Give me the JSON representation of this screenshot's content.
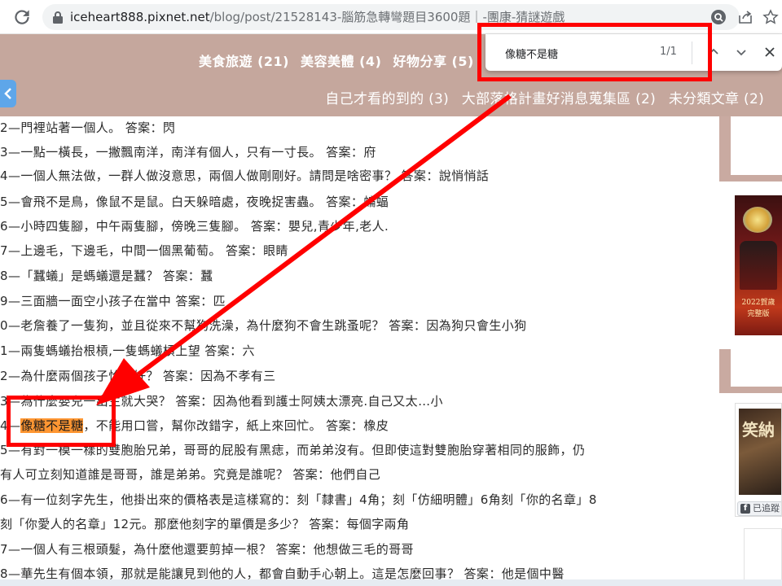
{
  "browser": {
    "url_host": "iceheart888.pixnet.net",
    "url_path": "/blog/post/21528143-腦筋急轉彎題目3600題｜-團康-猜謎遊戲",
    "icons": [
      "reload-icon",
      "lock-icon",
      "lens-icon",
      "share-icon",
      "star-icon"
    ]
  },
  "find_bar": {
    "query": "像糖不是糖",
    "count": "1/1",
    "icons": [
      "chevron-up-icon",
      "chevron-down-icon",
      "close-icon"
    ]
  },
  "categories_row1": [
    "美食旅遊 (21)",
    "美容美體 (4)",
    "好物分享 (5)"
  ],
  "categories_row2": [
    "自己才看的到的 (3)",
    "大部落格計畫好消息蒐集區 (2)",
    "未分類文章 (2)"
  ],
  "article_lines": [
    "2—門裡站著一個人。 答案：閃",
    "3—一點一橫長，一撇飄南洋，南洋有個人，只有一寸長。 答案：府",
    "4—一個人無法做，一群人做沒意思，兩個人做剛剛好。請問是啥密事？ 答案：說悄悄話",
    "5—會飛不是鳥，像鼠不是鼠。白天躲暗處，夜晚捉害蟲。 答案：蝙蝠",
    "6—小時四隻腳，中午兩隻腳，傍晚三隻腳。 答案：嬰兒,青少年,老人.",
    "7—上邊毛，下邊毛，中間一個黑葡萄。 答案：眼睛",
    "8—「蠶蟻」是螞蟻還是蠶？ 答案：蠶",
    "9—三面牆一面空小孩子在當中 答案：匹",
    "0—老詹養了一隻狗，並且從來不幫狗洗澡，為什麼狗不會生跳蚤呢？ 答案：因為狗只會生小狗",
    "1—兩隻螞蟻抬根槓,一隻螞蟻槓上望 答案：六",
    "2—為什麼兩個孩子恰恰好？ 答案：因為不孝有三",
    "3—為什麼嬰兒一出生就大哭？ 答案：因為他看到護士阿姨太漂亮.自己又太…小",
    "5—有對一模一樣的雙胞胎兄弟，哥哥的屁股有黑痣，而弟弟沒有。但即使這對雙胞胎穿著相同的服飾，仍",
    "有人可立刻知道誰是哥哥，誰是弟弟。究竟是誰呢？ 答案：他們自己",
    "6—有一位刻字先生，他掛出來的價格表是這樣寫的：刻「隸書」4角；刻「仿細明體」6角刻「你的名章」8",
    "刻「你愛人的名章」12元。那麼他刻字的單價是多少？ 答案：每個字兩角",
    "7—一個人有三根頭髮，為什麼他還要剪掉一根？ 答案：他想做三毛的哥哥",
    "8—華先生有個本領，那就是能讓見到他的人，都會自動手心朝上。這是怎麼回事？ 答案：他是個中醫"
  ],
  "highlight_line": {
    "prefix": "4—",
    "match": "像糖不是糖",
    "suffix": "，不能用口嘗，幫你改錯字，紙上來回忙。 答案：橡皮"
  },
  "sidebar": {
    "poster_caption_1": "2022賀歲",
    "poster_caption_2": "完整版",
    "fb_thumb_text": "笑納",
    "fb_button": "已追蹤"
  },
  "colors": {
    "header_bg": "#c5a79d",
    "highlight": "#ff9632",
    "annotation": "#ff0000",
    "back_tab": "#5ea6e9"
  }
}
